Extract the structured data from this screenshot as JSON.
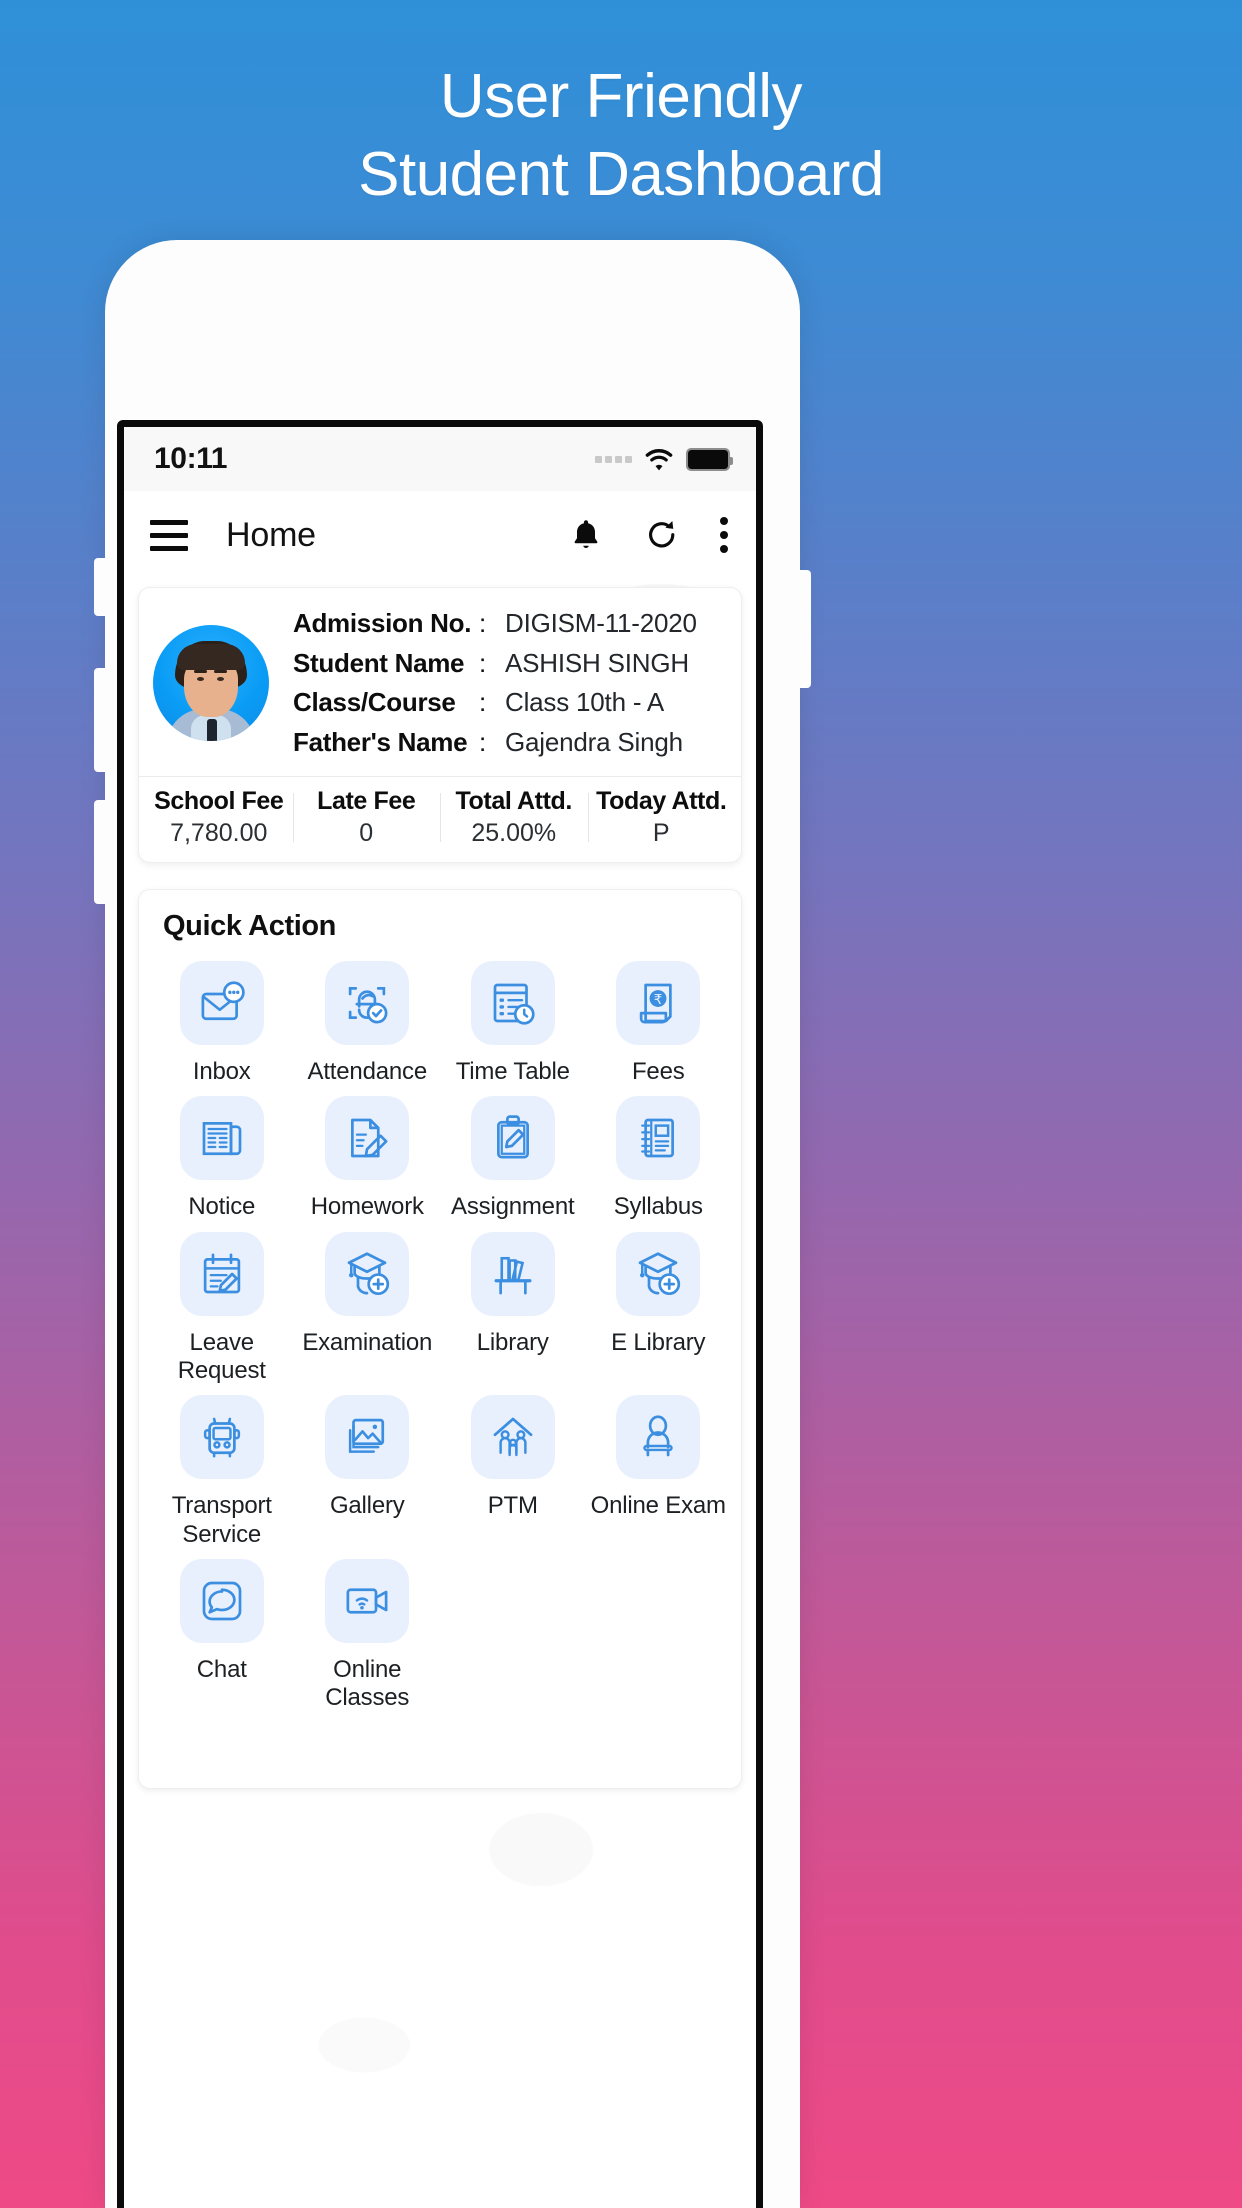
{
  "promo": {
    "line1": "User Friendly",
    "line2": "Student Dashboard"
  },
  "status_bar": {
    "time": "10:11",
    "signal_icon": "signal-dots-icon",
    "wifi_icon": "wifi-icon",
    "battery_icon": "battery-full-icon"
  },
  "app_bar": {
    "menu_icon": "hamburger-menu-icon",
    "title": "Home",
    "notification_icon": "bell-icon",
    "refresh_icon": "refresh-icon",
    "overflow_icon": "kebab-menu-icon"
  },
  "student_card": {
    "avatar_name": "student-avatar",
    "fields": [
      {
        "label": "Admission No.",
        "sep": ":",
        "value": "DIGISM-11-2020"
      },
      {
        "label": "Student Name",
        "sep": ":",
        "value": "ASHISH SINGH"
      },
      {
        "label": "Class/Course",
        "sep": ":",
        "value": "Class 10th - A"
      },
      {
        "label": "Father's Name",
        "sep": ":",
        "value": "Gajendra Singh"
      }
    ],
    "stats": [
      {
        "label": "School Fee",
        "value": "7,780.00"
      },
      {
        "label": "Late Fee",
        "value": "0"
      },
      {
        "label": "Total Attd.",
        "value": "25.00%"
      },
      {
        "label": "Today Attd.",
        "value": "P"
      }
    ]
  },
  "quick_action": {
    "title": "Quick Action",
    "items": [
      {
        "label": "Inbox",
        "icon": "inbox-message-icon"
      },
      {
        "label": "Attendance",
        "icon": "face-scan-check-icon"
      },
      {
        "label": "Time Table",
        "icon": "timetable-clock-icon"
      },
      {
        "label": "Fees",
        "icon": "rupee-bill-icon"
      },
      {
        "label": "Notice",
        "icon": "newspaper-icon"
      },
      {
        "label": "Homework",
        "icon": "document-pen-icon"
      },
      {
        "label": "Assignment",
        "icon": "clipboard-pen-icon"
      },
      {
        "label": "Syllabus",
        "icon": "notebook-icon"
      },
      {
        "label": "Leave Request",
        "icon": "calendar-pen-icon"
      },
      {
        "label": "Examination",
        "icon": "graduate-plus-icon"
      },
      {
        "label": "Library",
        "icon": "bookshelf-icon"
      },
      {
        "label": "E Library",
        "icon": "graduate-plus-icon"
      },
      {
        "label": "Transport Service",
        "icon": "bus-icon"
      },
      {
        "label": "Gallery",
        "icon": "photos-icon"
      },
      {
        "label": "PTM",
        "icon": "family-home-icon"
      },
      {
        "label": "Online Exam",
        "icon": "person-desk-icon"
      },
      {
        "label": "Chat",
        "icon": "chat-bubble-icon"
      },
      {
        "label": "Online Classes",
        "icon": "video-wifi-icon"
      }
    ]
  },
  "colors": {
    "background_top": "#2f90d8",
    "background_bottom": "#ee4a86",
    "tile_background": "#e8f0fe",
    "icon_stroke": "#3c8fe0",
    "avatar_background": "#0a9cf5"
  }
}
